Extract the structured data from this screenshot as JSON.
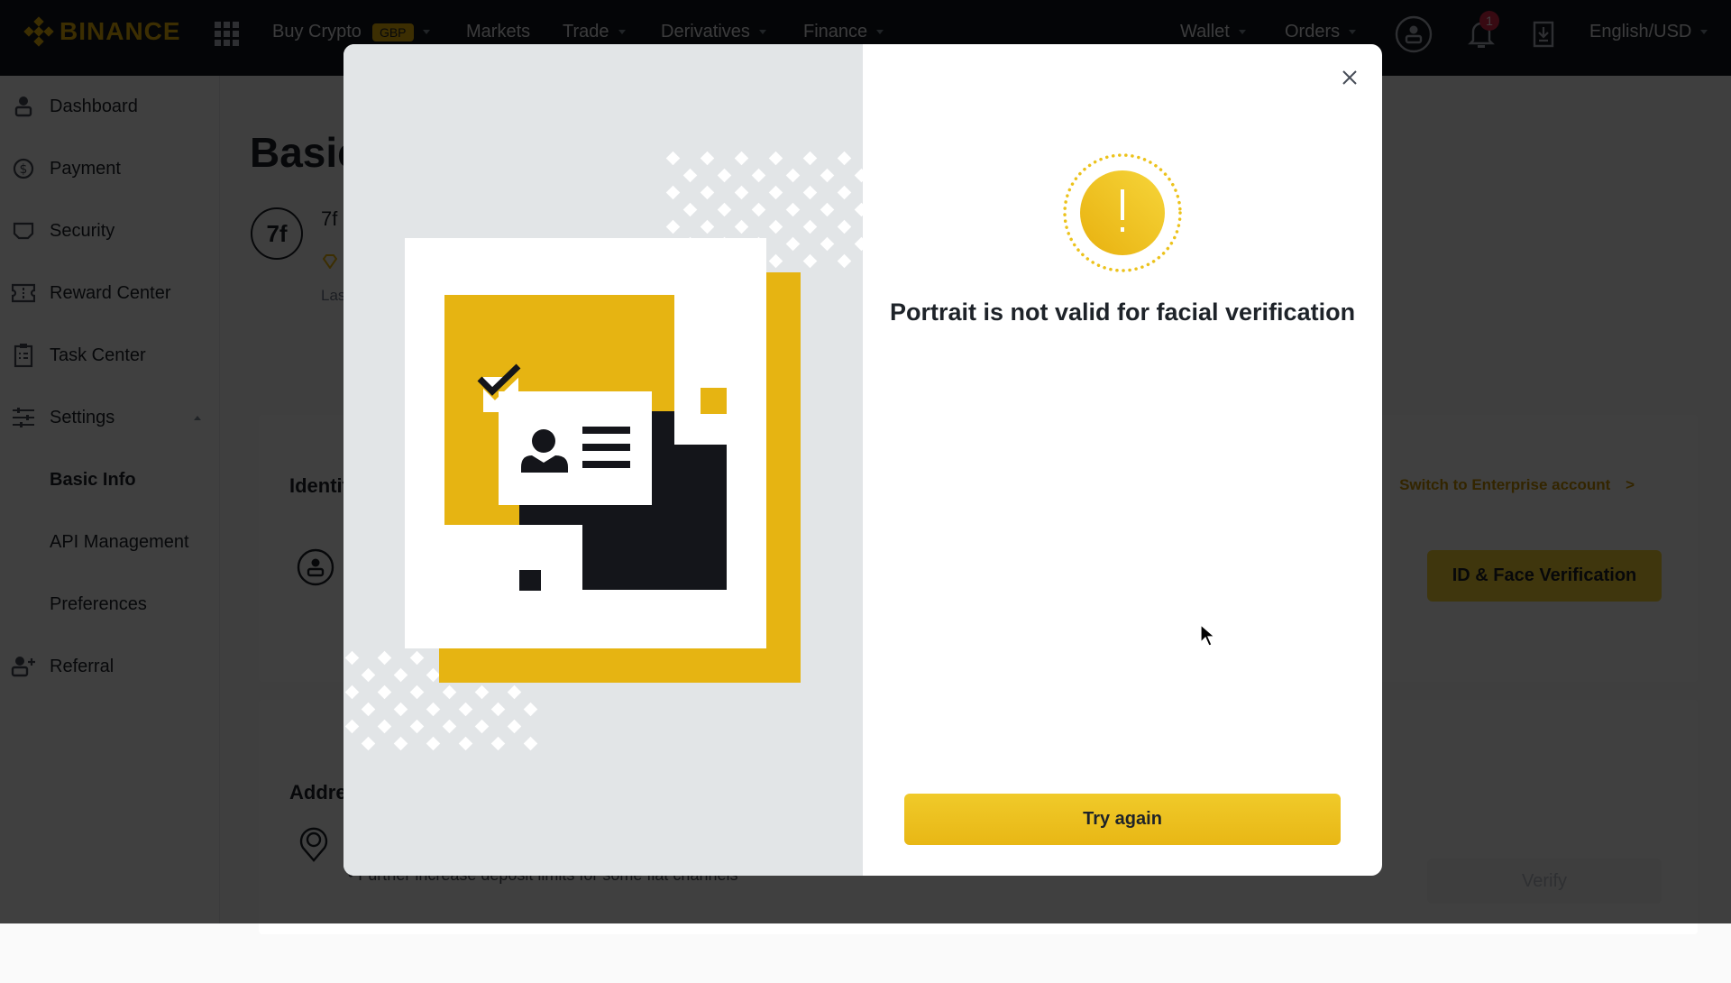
{
  "topnav": {
    "brand": "BINANCE",
    "items": [
      {
        "label": "Buy Crypto",
        "badge": "GBP",
        "has_dropdown": true
      },
      {
        "label": "Markets",
        "has_dropdown": false
      },
      {
        "label": "Trade",
        "has_dropdown": true
      },
      {
        "label": "Derivatives",
        "has_dropdown": true
      },
      {
        "label": "Finance",
        "has_dropdown": true
      }
    ],
    "right_items": [
      {
        "label": "Wallet",
        "has_dropdown": true
      },
      {
        "label": "Orders",
        "has_dropdown": true
      }
    ],
    "notification_count": "1",
    "language": "English/USD",
    "icons": [
      "apps-grid-icon",
      "profile-icon",
      "bell-icon",
      "download-icon"
    ]
  },
  "sidebar": {
    "items": [
      {
        "label": "Dashboard",
        "icon": "person-icon"
      },
      {
        "label": "Payment",
        "icon": "dollar-circle-icon"
      },
      {
        "label": "Security",
        "icon": "shield-icon"
      },
      {
        "label": "Reward Center",
        "icon": "ticket-icon"
      },
      {
        "label": "Task Center",
        "icon": "clipboard-icon"
      },
      {
        "label": "Settings",
        "icon": "sliders-icon",
        "expanded": true
      },
      {
        "label": "Basic Info",
        "sub": true,
        "active": true
      },
      {
        "label": "API Management",
        "sub": true
      },
      {
        "label": "Preferences",
        "sub": true
      },
      {
        "label": "Referral",
        "icon": "add-user-icon"
      }
    ]
  },
  "main": {
    "page_title": "Basic Info",
    "avatar_initials": "7f",
    "user_name_partial": "7f",
    "last_login_partial": "Las",
    "identity_section": {
      "title": "Identity Verification",
      "enterprise_link": "Switch to Enterprise account",
      "enterprise_chevron": ">",
      "verify_button": "ID & Face Verification"
    },
    "address_section": {
      "title": "Address Verification",
      "verify_button": "Verify",
      "note": "• Further increase deposit limits for some fiat channels"
    }
  },
  "modal": {
    "title": "Portrait is not valid for facial verification",
    "primary_button": "Try again",
    "close_label": "×",
    "warning_glyph": "!",
    "colors": {
      "accent": "#f0b90b",
      "illustration_yellow": "#e6b412",
      "illustration_black": "#14151a",
      "panel_bg": "#e2e5e7"
    }
  }
}
